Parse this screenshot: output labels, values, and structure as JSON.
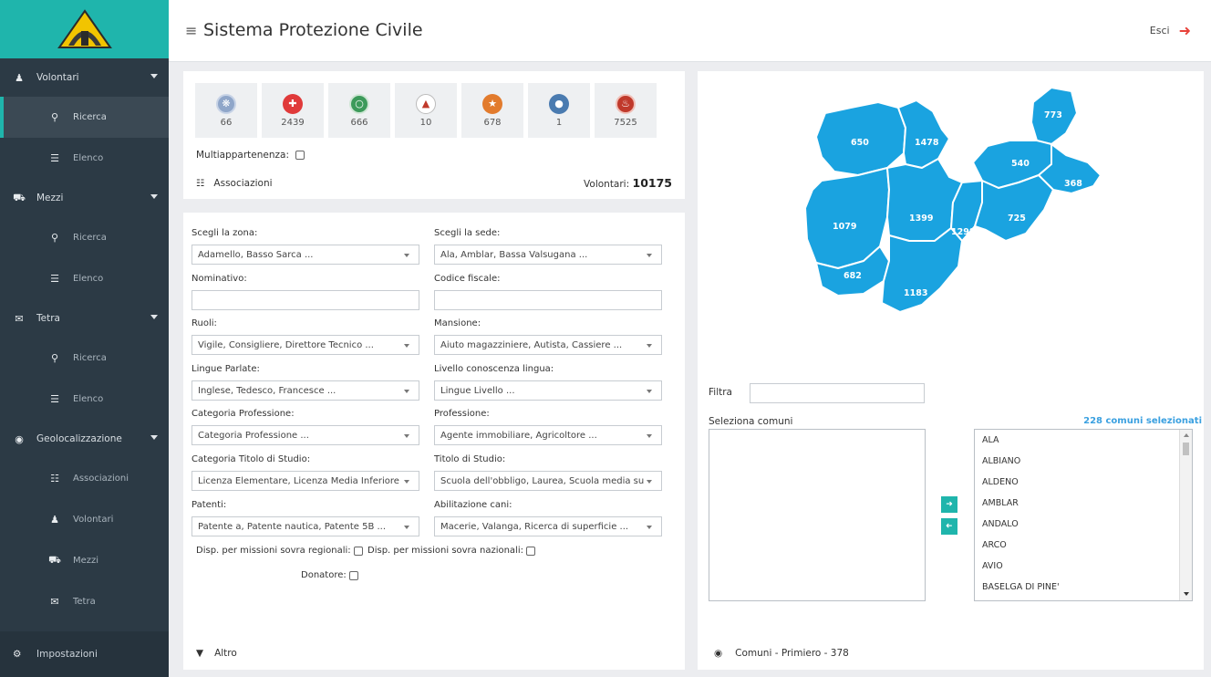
{
  "app": {
    "title": "Sistema Protezione Civile",
    "exit_label": "Esci"
  },
  "sidebar": {
    "sections": [
      {
        "label": "Volontari",
        "icon": "user-icon",
        "subs": [
          {
            "label": "Ricerca",
            "icon": "search-icon",
            "active": true
          },
          {
            "label": "Elenco",
            "icon": "list-icon"
          }
        ]
      },
      {
        "label": "Mezzi",
        "icon": "car-icon",
        "subs": [
          {
            "label": "Ricerca",
            "icon": "search-icon"
          },
          {
            "label": "Elenco",
            "icon": "list-icon"
          }
        ]
      },
      {
        "label": "Tetra",
        "icon": "megaphone-icon",
        "subs": [
          {
            "label": "Ricerca",
            "icon": "search-icon"
          },
          {
            "label": "Elenco",
            "icon": "list-icon"
          }
        ]
      },
      {
        "label": "Geolocalizzazione",
        "icon": "map-marker-icon",
        "subs": [
          {
            "label": "Associazioni",
            "icon": "sitemap-icon"
          },
          {
            "label": "Volontari",
            "icon": "user-icon"
          },
          {
            "label": "Mezzi",
            "icon": "car-icon"
          },
          {
            "label": "Tetra",
            "icon": "megaphone-icon"
          }
        ]
      }
    ],
    "settings_label": "Impostazioni"
  },
  "associations": {
    "tiles": [
      {
        "count": "66",
        "color": "#8fa6c9"
      },
      {
        "count": "2439",
        "color": "#e03a3a"
      },
      {
        "count": "666",
        "color": "#3c9a5a"
      },
      {
        "count": "10",
        "color": "#ffffff"
      },
      {
        "count": "678",
        "color": "#e27b2d"
      },
      {
        "count": "1",
        "color": "#4a7bb0"
      },
      {
        "count": "7525",
        "color": "#c0392b"
      }
    ],
    "multi_label": "Multiappartenenza:",
    "footer_label": "Associazioni",
    "volunteers_label": "Volontari:",
    "volunteers_total": "10175"
  },
  "form": {
    "fields": [
      {
        "label": "Scegli la zona:",
        "value": "Adamello, Basso Sarca ...",
        "type": "select"
      },
      {
        "label": "Scegli la sede:",
        "value": "Ala, Amblar, Bassa Valsugana ...",
        "type": "select"
      },
      {
        "label": "Nominativo:",
        "value": "",
        "type": "input"
      },
      {
        "label": "Codice fiscale:",
        "value": "",
        "type": "input"
      },
      {
        "label": "Ruoli:",
        "value": "Vigile, Consigliere, Direttore Tecnico ...",
        "type": "select"
      },
      {
        "label": "Mansione:",
        "value": "Aiuto magazziniere, Autista, Cassiere ...",
        "type": "select"
      },
      {
        "label": "Lingue Parlate:",
        "value": "Inglese, Tedesco, Francesce ...",
        "type": "select"
      },
      {
        "label": "Livello conoscenza lingua:",
        "value": "Lingue Livello ...",
        "type": "select"
      },
      {
        "label": "Categoria Professione:",
        "value": "Categoria Professione ...",
        "type": "select"
      },
      {
        "label": "Professione:",
        "value": "Agente immobiliare, Agricoltore ...",
        "type": "select"
      },
      {
        "label": "Categoria Titolo di Studio:",
        "value": "Licenza Elementare, Licenza Media Inferiore",
        "type": "select"
      },
      {
        "label": "Titolo di Studio:",
        "value": "Scuola dell'obbligo, Laurea, Scuola media su",
        "type": "select"
      },
      {
        "label": "Patenti:",
        "value": "Patente a, Patente nautica, Patente 5B ...",
        "type": "select"
      },
      {
        "label": "Abilitazione cani:",
        "value": "Macerie, Valanga, Ricerca di superficie ...",
        "type": "select"
      }
    ],
    "disp_regional": "Disp. per missioni sovra regionali:",
    "disp_national": "Disp. per missioni sovra nazionali:",
    "donatore": "Donatore:",
    "footer_label": "Altro"
  },
  "map": {
    "region_counts": [
      "650",
      "1478",
      "773",
      "540",
      "368",
      "1079",
      "1399",
      "1298",
      "725",
      "682",
      "1183"
    ],
    "fill_color": "#1aa3e0",
    "filter_label": "Filtra",
    "select_label": "Seleziona comuni",
    "selected_count": "228 comuni selezionati",
    "comuni": [
      "ALA",
      "ALBIANO",
      "ALDENO",
      "AMBLAR",
      "ANDALO",
      "ARCO",
      "AVIO",
      "BASELGA DI PINE'"
    ],
    "footer_label": "Comuni - Primiero - 378"
  }
}
